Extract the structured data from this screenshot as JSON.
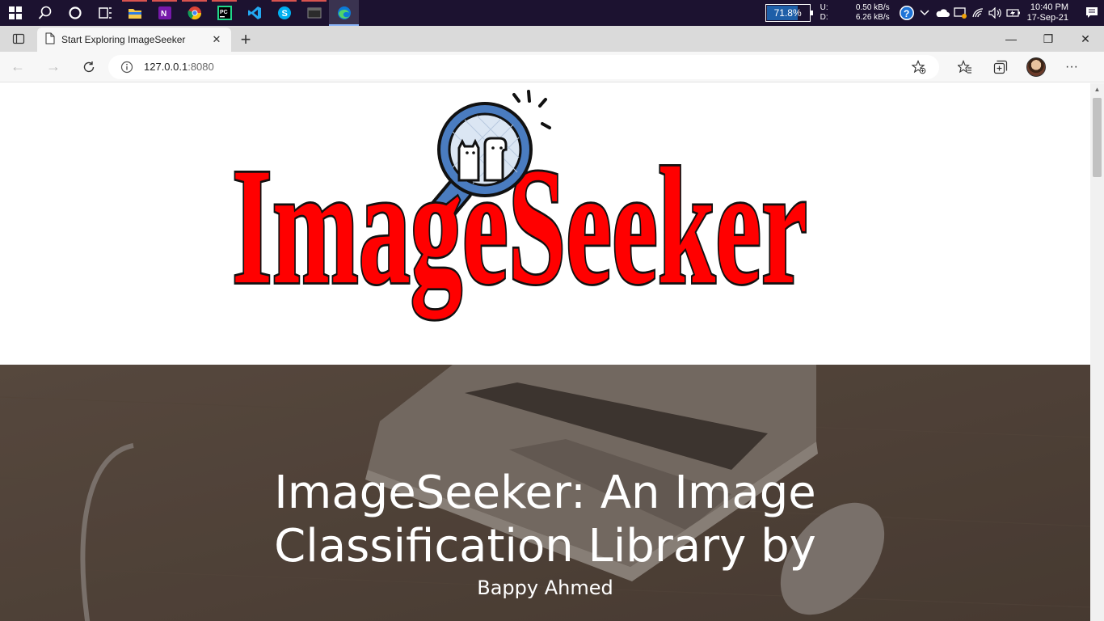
{
  "taskbar": {
    "apps": [
      {
        "name": "windows-start-icon"
      },
      {
        "name": "search-icon"
      },
      {
        "name": "cortana-icon"
      },
      {
        "name": "task-view-icon"
      },
      {
        "name": "file-explorer-icon"
      },
      {
        "name": "onenote-icon"
      },
      {
        "name": "chrome-icon"
      },
      {
        "name": "pycharm-icon"
      },
      {
        "name": "vscode-icon"
      },
      {
        "name": "skype-icon"
      },
      {
        "name": "terminal-icon"
      },
      {
        "name": "edge-icon"
      }
    ],
    "battery_percent": "71.8%",
    "net_up_label": "U:",
    "net_down_label": "D:",
    "net_up_value": "0.50 kB/s",
    "net_down_value": "6.26 kB/s",
    "time": "10:40 PM",
    "date": "17-Sep-21"
  },
  "browser": {
    "tab_title": "Start Exploring ImageSeeker",
    "url_host": "127.0.0.1",
    "url_port": ":8080"
  },
  "page": {
    "logo_text": "ImageSeeker",
    "hero_title_line1": "ImageSeeker: An Image",
    "hero_title_line2": "Classification Library by",
    "hero_subtitle": "Bappy Ahmed"
  },
  "colors": {
    "logo_red": "#ff0000",
    "hero_bg": "#54463c",
    "taskbar_bg": "#1c1230"
  }
}
